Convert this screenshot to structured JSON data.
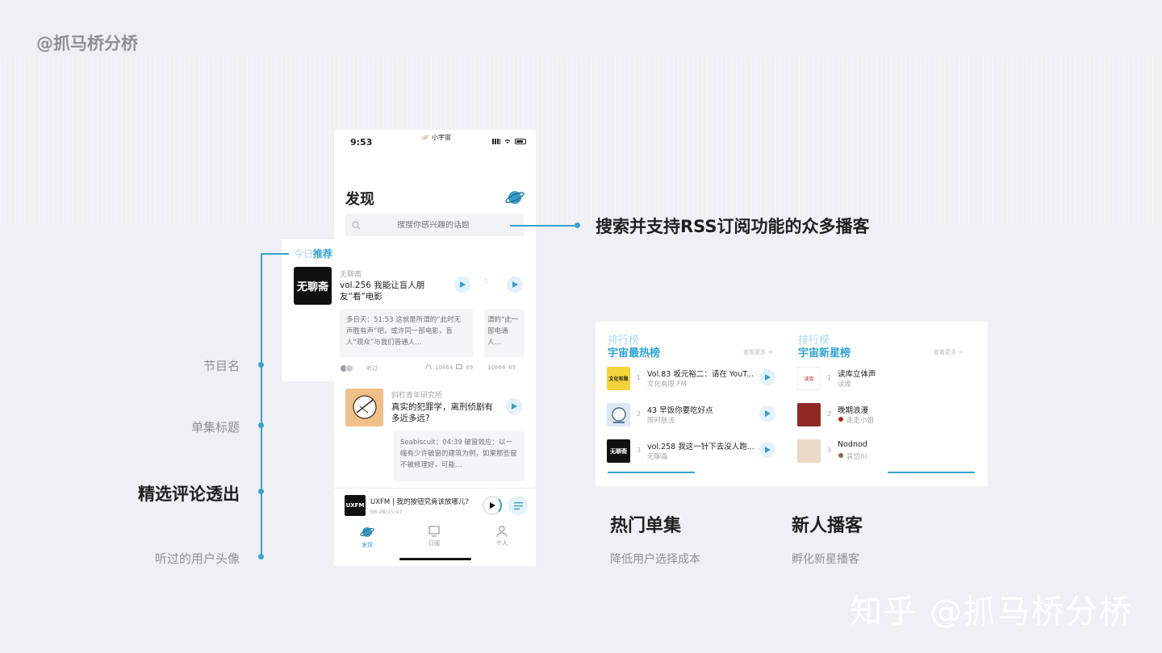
{
  "brand": "@抓马桥分桥",
  "watermark": "知乎 @抓马桥分桥",
  "phone": {
    "status_time": "9:53",
    "status_app": "小宇宙",
    "title": "发现",
    "search_placeholder": "搜搜你感兴趣的话题",
    "section": {
      "light": "今日",
      "bold": "推荐"
    },
    "card1": {
      "podcast": "无聊斋",
      "cover_text": "无聊斋",
      "title": "vol.256 我能让盲人朋友“看”电影",
      "comment": "多日天：51:53 这就是所谓的“此时无声胜有声”吧，或许同一部电影，盲人“观众”与我们普通人…",
      "listened": "听过",
      "plays": "10864",
      "comments": "69"
    },
    "card1_peek": {
      "colon": ":",
      "comment": "谓的“此一部电通人…",
      "plays": "10864",
      "comments": "69"
    },
    "card2": {
      "podcast": "斜杠青年研究所",
      "title": "真实的犯罪学，离刑侦剧有多近多远?",
      "comment": "Seabiscuit：04:39 破窗效应：以一幢有少许破窗的建筑为例，如果那些窗不被修理好，可能…"
    },
    "miniplayer": {
      "title": "UXFM | 我的按钮究竟该放哪儿?",
      "time": "08:28/15:47",
      "cover_text": "UXFM"
    },
    "tabs": [
      "发现",
      "订阅",
      "个人"
    ]
  },
  "annotations": {
    "search_callout": "搜索并支持RSS订阅功能的众多播客",
    "labels": [
      "节目名",
      "单集标题",
      "精选评论透出",
      "听过的用户头像"
    ]
  },
  "rankings": {
    "hot": {
      "light": "排行榜",
      "title": "宇宙最热榜",
      "more": "查看更多 →",
      "items": [
        {
          "num": "1",
          "title": "Vol.83 坂元裕二：请在 YouT...",
          "sub": "文化有限 FM",
          "cover": "文化有限"
        },
        {
          "num": "2",
          "title": "43 早饭你要吃好点",
          "sub": "限时肤浅",
          "cover": ""
        },
        {
          "num": "3",
          "title": "vol.258 我这一针下去没人跑...",
          "sub": "无聊斋",
          "cover": "无聊斋"
        }
      ]
    },
    "new": {
      "light": "排行榜",
      "title": "宇宙新星榜",
      "more": "查看更多 →",
      "items": [
        {
          "num": "1",
          "title": "读库立体声",
          "sub": "读库",
          "cover": "读库"
        },
        {
          "num": "2",
          "title": "晚期浪漫",
          "sub": "走走小姐",
          "cover": ""
        },
        {
          "num": "3",
          "title": "Nodnod",
          "sub": "袁岱川",
          "cover": ""
        }
      ]
    }
  },
  "features": [
    {
      "title": "热门单集",
      "sub": "降低用户选择成本"
    },
    {
      "title": "新人播客",
      "sub": "孵化新星播客"
    }
  ],
  "colors": {
    "accent": "#3aa3cc",
    "accent_light": "#a9d7ea",
    "bg": "#eef0f3"
  }
}
